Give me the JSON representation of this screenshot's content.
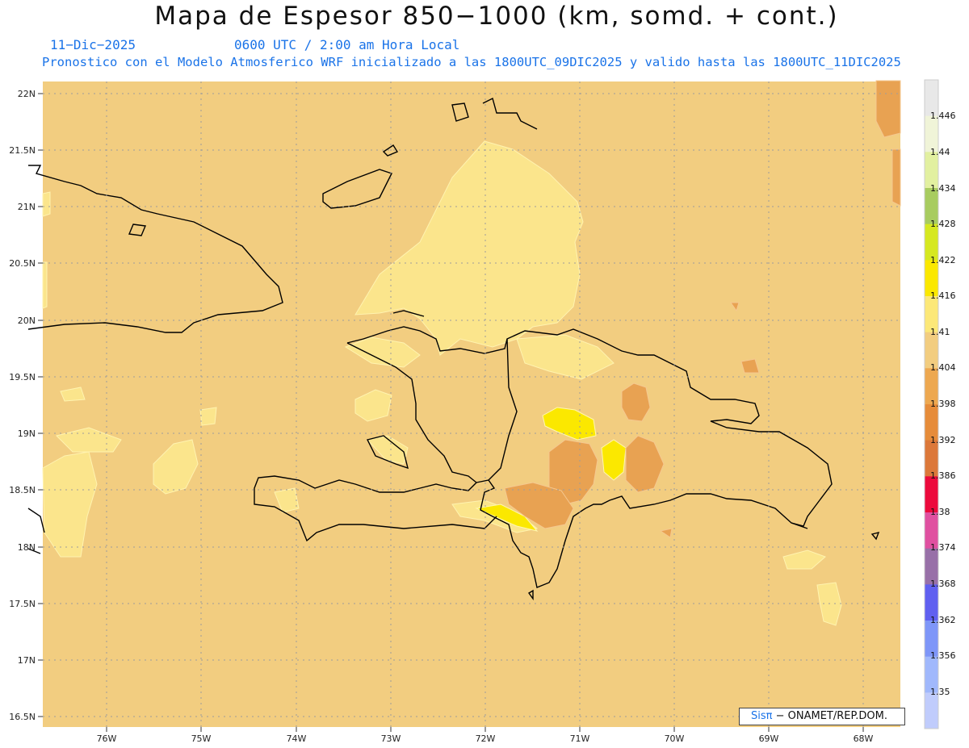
{
  "header": {
    "title": "Mapa de Espesor 850−1000 (km, somd. + cont.)",
    "date": "11−Dic−2025",
    "time": "0600 UTC / 2:00 am Hora Local",
    "forecast": "Pronostico con el Modelo Atmosferico WRF inicializado a las 1800UTC_09DIC2025 y valido hasta las  1800UTC_11DIC2025"
  },
  "map": {
    "lat_labels": [
      "22N",
      "21.5N",
      "21N",
      "20.5N",
      "20N",
      "19.5N",
      "19N",
      "18.5N",
      "18N",
      "17.5N",
      "17N",
      "16.5N"
    ],
    "lon_labels": [
      "76W",
      "75W",
      "74W",
      "73W",
      "72W",
      "71W",
      "70W",
      "69W",
      "68W"
    ],
    "background_color": "#f2cd80",
    "coastline_color": "#000000"
  },
  "colorbar": {
    "labels": [
      "1.446",
      "1.44",
      "1.434",
      "1.428",
      "1.422",
      "1.416",
      "1.41",
      "1.404",
      "1.398",
      "1.392",
      "1.386",
      "1.38",
      "1.374",
      "1.368",
      "1.362",
      "1.356",
      "1.35"
    ],
    "colors": [
      "#e8e8e8",
      "#f0f4d8",
      "#e2f0a0",
      "#a8cc60",
      "#d6e820",
      "#fbe800",
      "#fce878",
      "#f2cd80",
      "#eda850",
      "#e68c3a",
      "#dc783a",
      "#ec0a3c",
      "#e050a0",
      "#9870a8",
      "#6060f0",
      "#7e96f8",
      "#a0b8fc",
      "#c0ccfc"
    ]
  },
  "credit": {
    "sis": "Sisπ",
    "text": " − ONAMET/REP.DOM."
  }
}
